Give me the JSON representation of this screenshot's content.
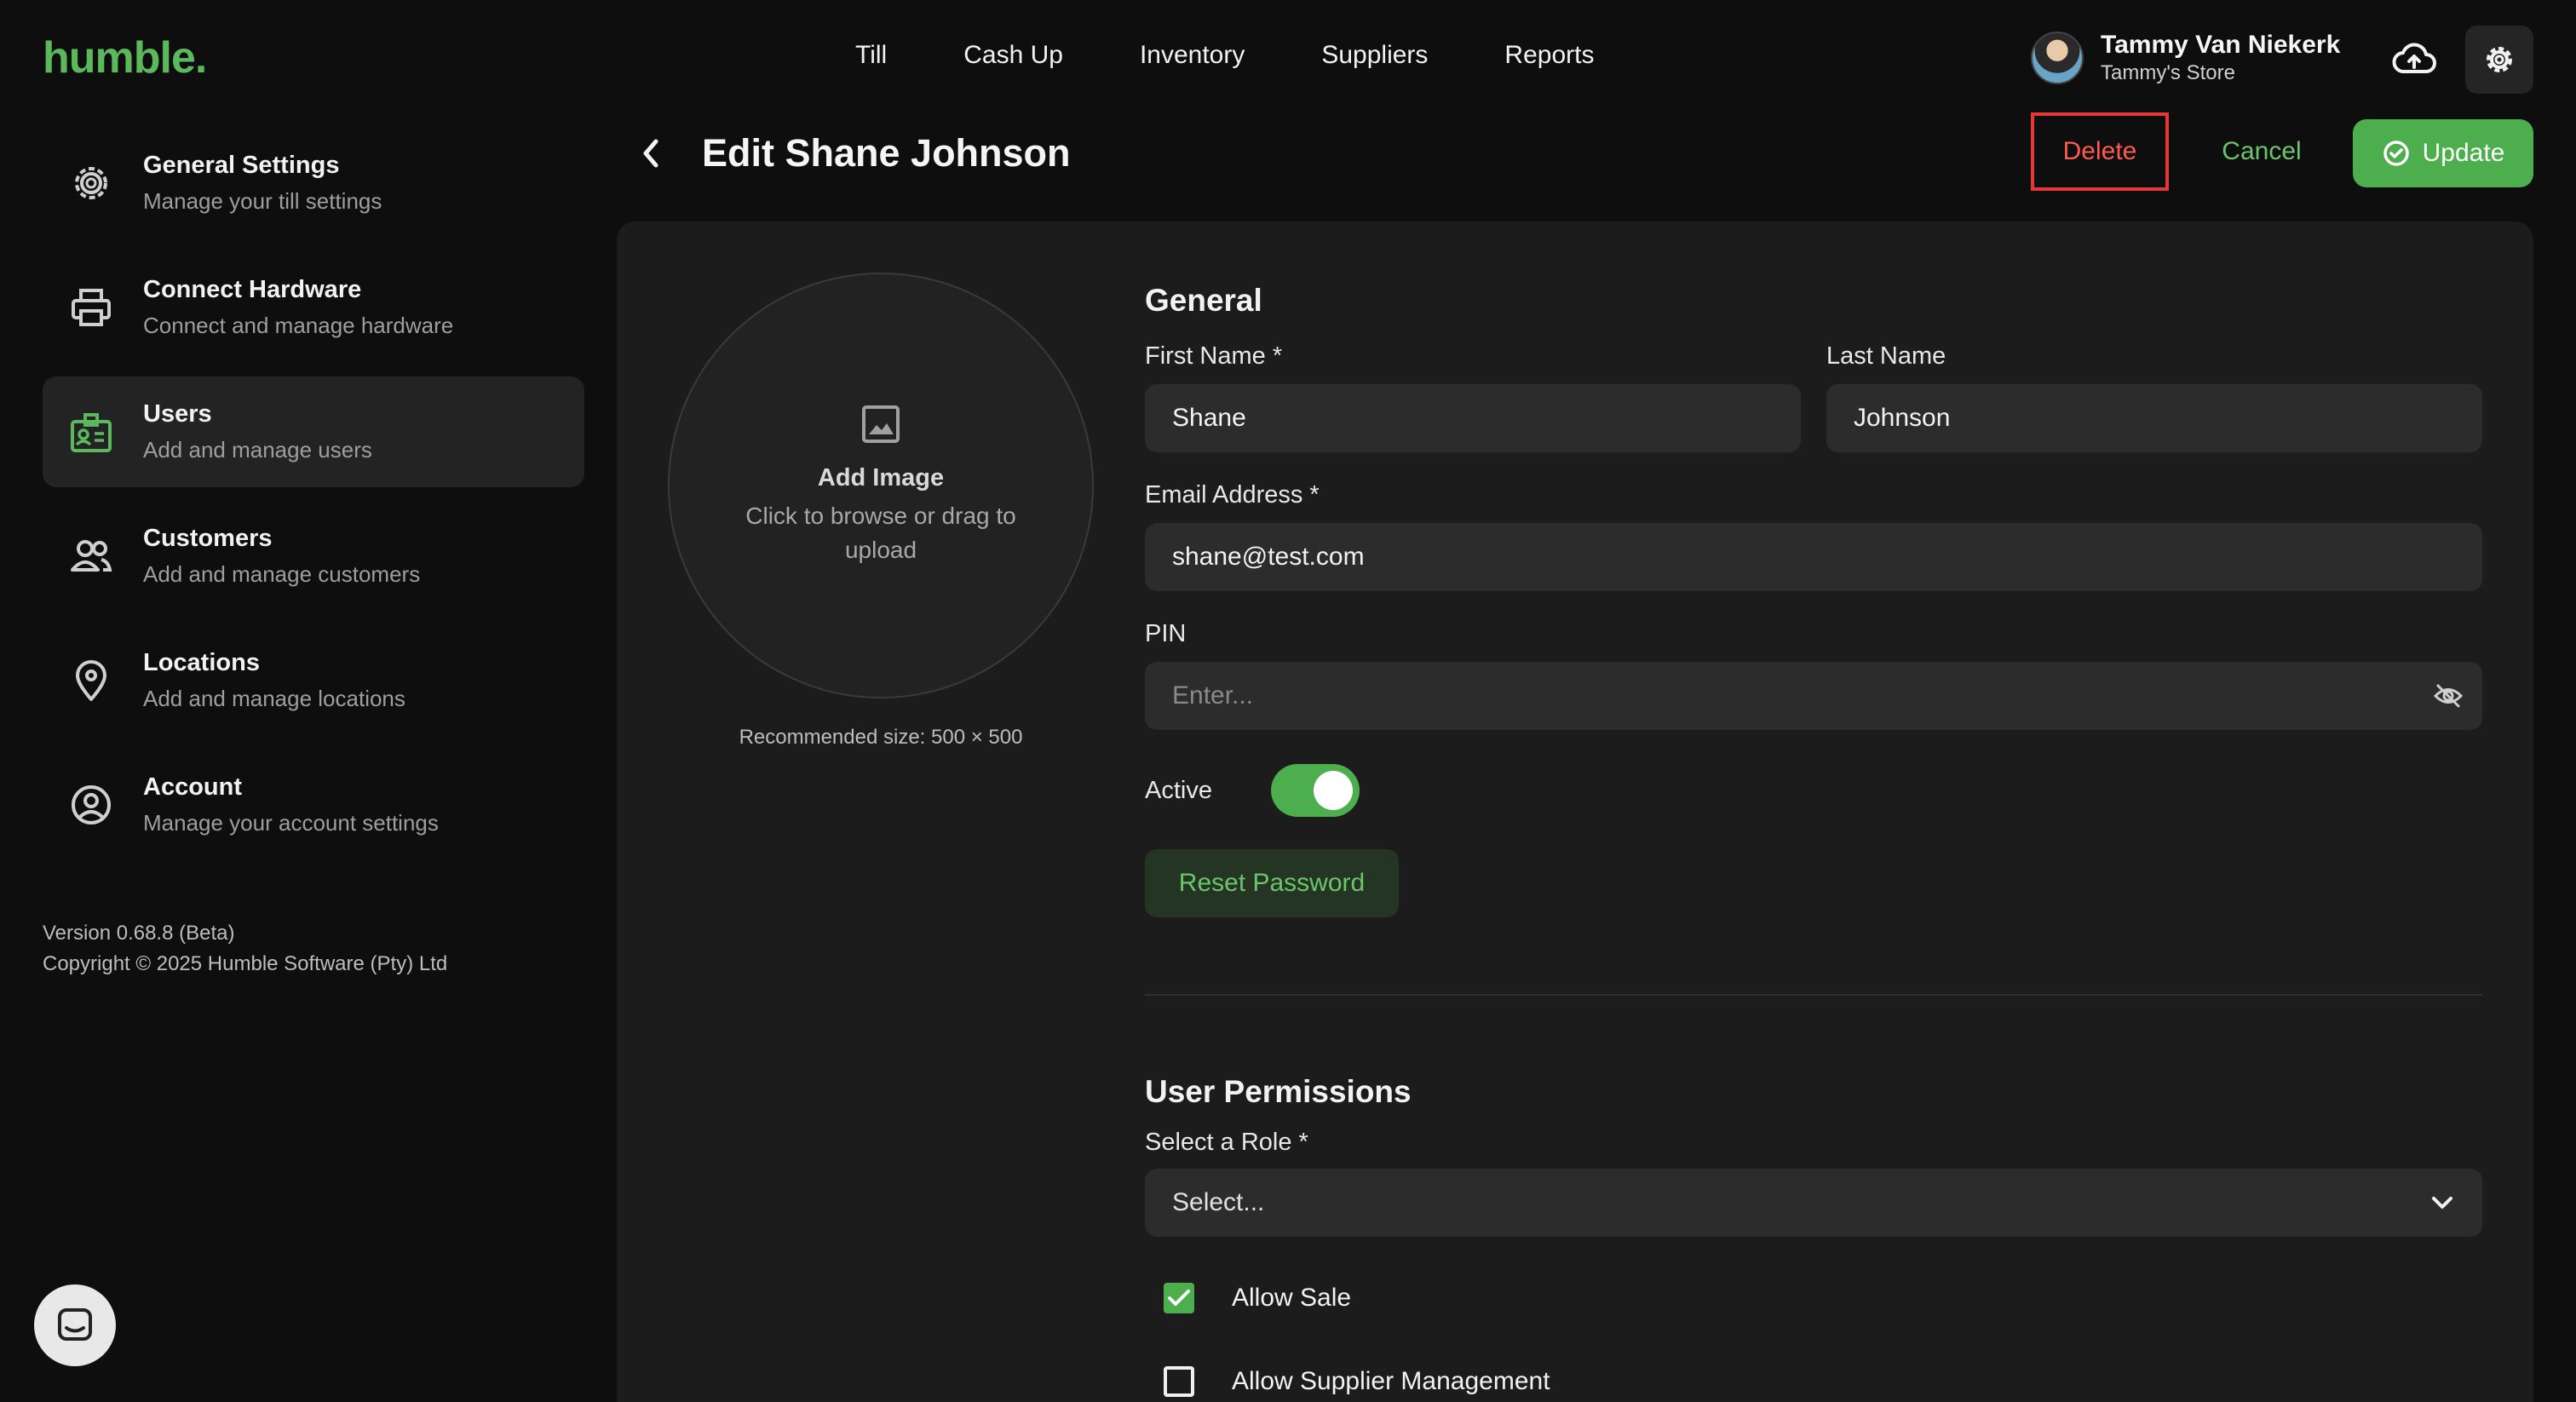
{
  "app": {
    "logo": "humble."
  },
  "nav": {
    "items": [
      "Till",
      "Cash Up",
      "Inventory",
      "Suppliers",
      "Reports"
    ]
  },
  "user": {
    "name": "Tammy Van Niekerk",
    "store": "Tammy's Store"
  },
  "sidebar": {
    "items": [
      {
        "title": "General Settings",
        "subtitle": "Manage your till settings",
        "icon": "gear-icon"
      },
      {
        "title": "Connect Hardware",
        "subtitle": "Connect and manage hardware",
        "icon": "printer-icon"
      },
      {
        "title": "Users",
        "subtitle": "Add and manage users",
        "icon": "id-badge-icon"
      },
      {
        "title": "Customers",
        "subtitle": "Add and manage customers",
        "icon": "people-icon"
      },
      {
        "title": "Locations",
        "subtitle": "Add and manage locations",
        "icon": "location-pin-icon"
      },
      {
        "title": "Account",
        "subtitle": "Manage your account settings",
        "icon": "account-icon"
      }
    ],
    "version": "Version 0.68.8 (Beta)",
    "copyright": "Copyright © 2025 Humble Software (Pty) Ltd"
  },
  "header": {
    "title": "Edit Shane Johnson",
    "delete_label": "Delete",
    "cancel_label": "Cancel",
    "update_label": "Update"
  },
  "image_upload": {
    "title": "Add Image",
    "subtitle": "Click to browse or drag to upload",
    "recommended": "Recommended size: 500 × 500"
  },
  "general": {
    "section_title": "General",
    "first_name_label": "First Name *",
    "first_name_value": "Shane",
    "last_name_label": "Last Name",
    "last_name_value": "Johnson",
    "email_label": "Email Address *",
    "email_value": "shane@test.com",
    "pin_label": "PIN",
    "pin_placeholder": "Enter...",
    "active_label": "Active",
    "reset_password_label": "Reset Password"
  },
  "permissions": {
    "section_title": "User Permissions",
    "role_label": "Select a Role *",
    "role_placeholder": "Select...",
    "items": [
      {
        "label": "Allow Sale",
        "checked": true
      },
      {
        "label": "Allow Supplier Management",
        "checked": false
      }
    ]
  },
  "colors": {
    "accent": "#4cae4c",
    "danger": "#e53935",
    "background": "#0e0e0e",
    "panel": "#1c1c1c"
  }
}
